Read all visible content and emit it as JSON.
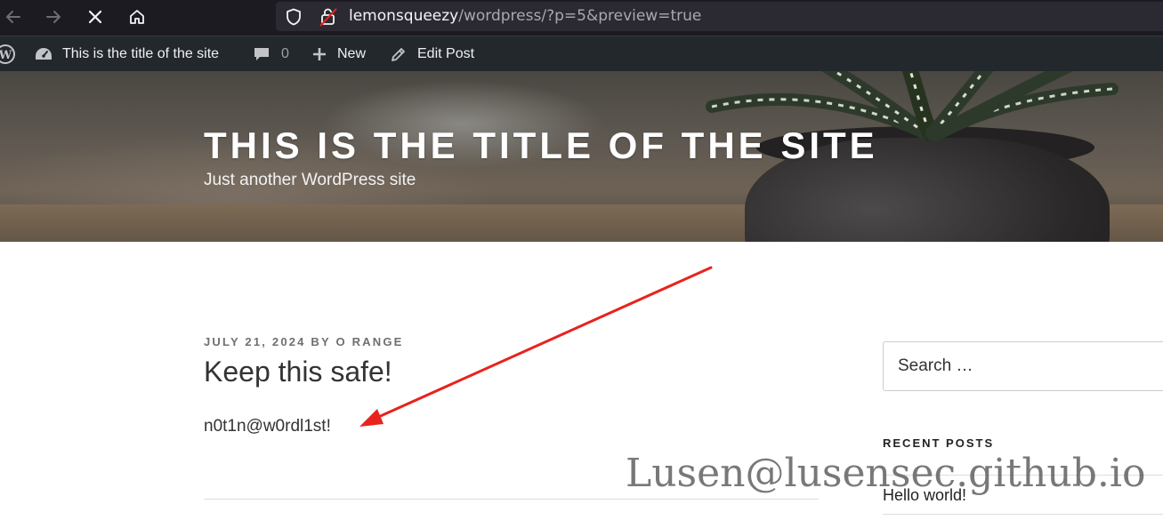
{
  "browser": {
    "url_host": "lemonsqueezy",
    "url_path": "/wordpress/?p=5&preview=true",
    "icons": [
      "back-icon",
      "forward-icon",
      "stop-icon",
      "home-icon",
      "shield-icon",
      "lock-warning-icon"
    ]
  },
  "admin_bar": {
    "site_name": "This is the title of the site",
    "comments_count": "0",
    "new_label": "New",
    "edit_label": "Edit Post"
  },
  "header": {
    "title": "THIS IS THE TITLE OF THE SITE",
    "description": "Just another WordPress site"
  },
  "post": {
    "meta": "JULY 21, 2024 BY O RANGE",
    "title": "Keep this safe!",
    "body": "n0t1n@w0rdl1st!"
  },
  "sidebar": {
    "search_placeholder": "Search …",
    "recent_posts_title": "RECENT POSTS",
    "recent_posts": [
      "Hello world!"
    ]
  },
  "annotation": {
    "watermark": "Lusen@lusensec.github.io",
    "arrow_color": "#e8231e"
  }
}
